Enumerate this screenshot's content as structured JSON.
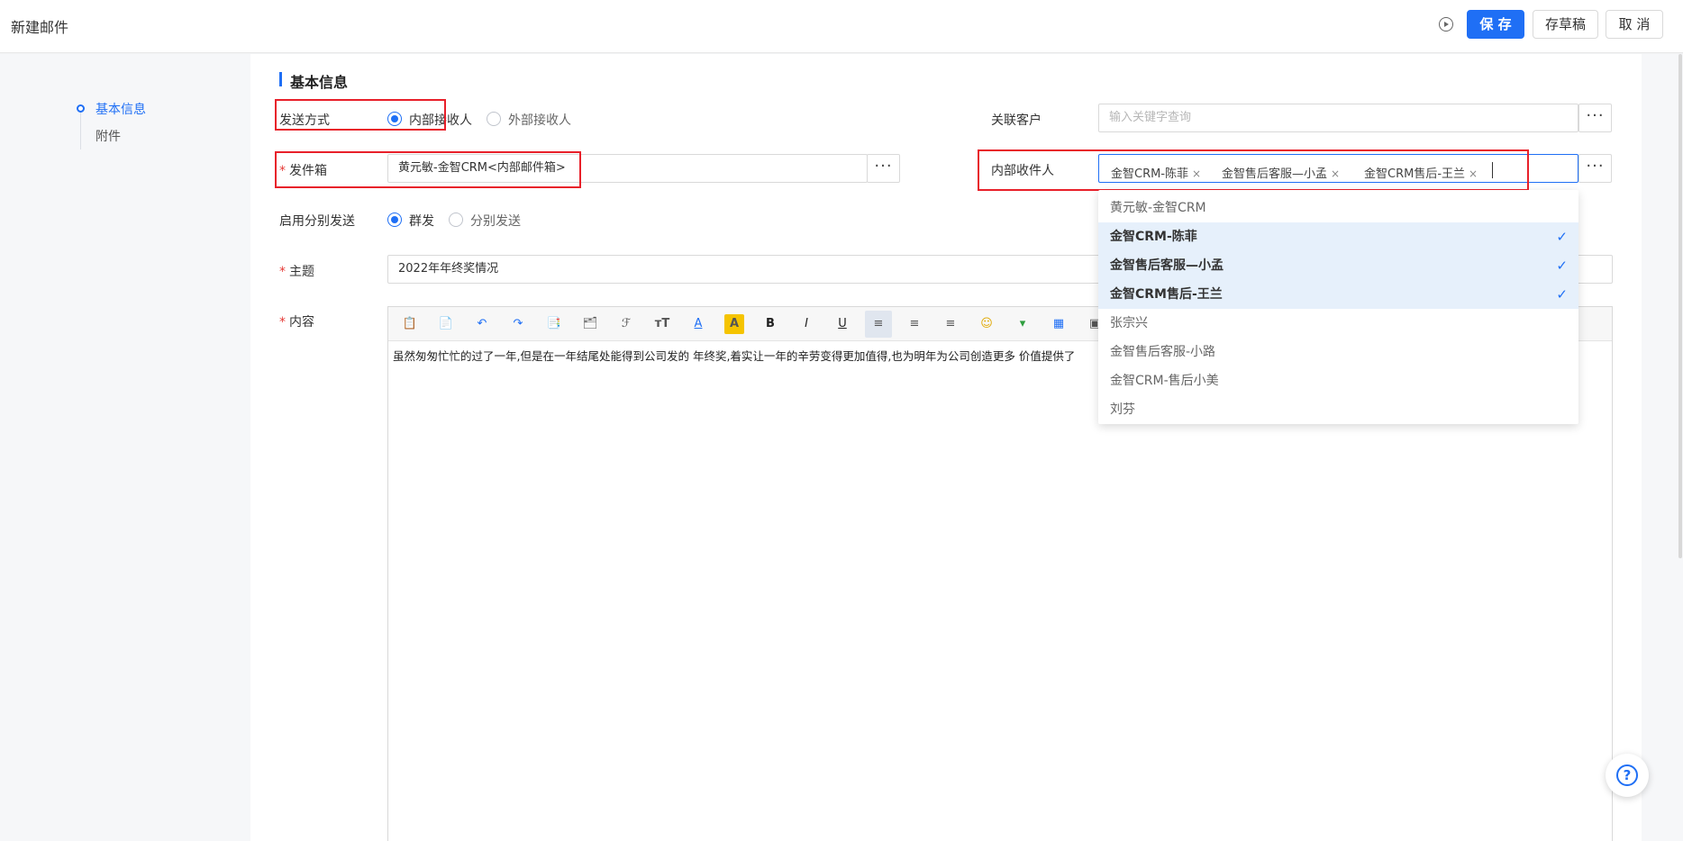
{
  "header": {
    "title": "新建邮件",
    "save_label": "保 存",
    "draft_label": "存草稿",
    "cancel_label": "取 消"
  },
  "anchors": [
    {
      "label": "基本信息",
      "active": true
    },
    {
      "label": "附件",
      "active": false
    }
  ],
  "section": {
    "title": "基本信息"
  },
  "form": {
    "send_mode": {
      "label": "发送方式",
      "options": [
        "内部接收人",
        "外部接收人"
      ],
      "selected": "内部接收人"
    },
    "related_customer": {
      "label": "关联客户",
      "placeholder": "输入关键字查询"
    },
    "outbox": {
      "label": "发件箱",
      "value": "黄元敏-金智CRM<内部邮件箱>"
    },
    "internal_recipients": {
      "label": "内部收件人",
      "tags": [
        "金智CRM-陈菲",
        "金智售后客服—小孟",
        "金智CRM售后-王兰"
      ]
    },
    "split_send": {
      "label": "启用分别发送",
      "options": [
        "群发",
        "分别发送"
      ],
      "selected": "群发"
    },
    "subject": {
      "label": "主题",
      "value": "2022年年终奖情况"
    },
    "content": {
      "label": "内容",
      "text": "虽然匆匆忙忙的过了一年,但是在一年结尾处能得到公司发的 年终奖,着实让一年的辛劳变得更加值得,也为明年为公司创造更多 价值提供了"
    },
    "more_symbol": "···"
  },
  "dropdown": {
    "items": [
      {
        "label": "黄元敏-金智CRM",
        "selected": false
      },
      {
        "label": "金智CRM-陈菲",
        "selected": true
      },
      {
        "label": "金智售后客服—小孟",
        "selected": true
      },
      {
        "label": "金智CRM售后-王兰",
        "selected": true
      },
      {
        "label": "张宗兴",
        "selected": false
      },
      {
        "label": "金智售后客服-小路",
        "selected": false
      },
      {
        "label": "金智CRM-售后小美",
        "selected": false
      },
      {
        "label": "刘芬",
        "selected": false
      }
    ],
    "check_symbol": "✓"
  },
  "toolbar_icons": [
    "paste-icon",
    "template-icon",
    "undo-icon",
    "redo-icon",
    "paste-text-icon",
    "paste-word-icon",
    "font-family-icon",
    "font-size-icon",
    "font-color-icon",
    "highlight-icon",
    "bold-icon",
    "italic-icon",
    "underline-icon",
    "align-left-icon",
    "align-center-icon",
    "align-right-icon",
    "emoji-icon",
    "insert-line-icon",
    "table-icon",
    "image-icon"
  ],
  "toolbar_glyphs": {
    "bold": "B",
    "italic": "I",
    "underline": "U",
    "font_size": "тT",
    "font_color": "A",
    "highlight": "A",
    "emoji": "☺",
    "undo": "↶",
    "redo": "↷",
    "font_family": "ℱ"
  },
  "help": {
    "symbol": "?"
  },
  "colors": {
    "accent": "#1f6ff5",
    "highlight_box": "#e8202a",
    "selected_bg": "#e6f0fb"
  }
}
